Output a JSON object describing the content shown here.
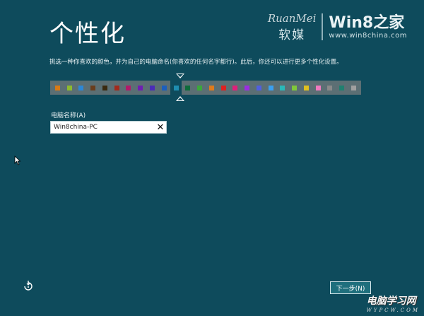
{
  "page": {
    "title": "个性化",
    "instruction": "挑选一种你喜欢的颜色，并为自己的电脑命名(你喜欢的任何名字都行)。此后，你还可以进行更多个性化设置。"
  },
  "logo": {
    "ruanmei_latin": "RuanMei",
    "ruanmei_cn": "软媒",
    "win8_brand": "Win8之家",
    "url": "www.win8china.com"
  },
  "colors": {
    "background": "#0e4b5c",
    "palette_bar": "#5c6f74",
    "button_bg": "#1f6f7d",
    "swatches": [
      "#d97a15",
      "#8dbb2d",
      "#2c87d6",
      "#6a3d1d",
      "#3a2a10",
      "#a22a1c",
      "#b21a6a",
      "#6f1db3",
      "#4a2cb8",
      "#1c5fbd",
      "#1e8db0",
      "#0e6b3a",
      "#3aa93a",
      "#e07b1c",
      "#e02020",
      "#e0207a",
      "#9b2ee0",
      "#4f5fe0",
      "#3aa0f0",
      "#2ab8b8",
      "#80c83a",
      "#e0c020",
      "#f07ac0",
      "#8a8a8a",
      "#208070",
      "#a0a0a0"
    ],
    "selected_index": 10
  },
  "form": {
    "label": "电脑名称(A)",
    "value": "Win8china-PC"
  },
  "actions": {
    "next_label": "下一步(N)"
  },
  "watermark": {
    "main": "电脑学习网",
    "sub": "WYPCW.COM"
  }
}
